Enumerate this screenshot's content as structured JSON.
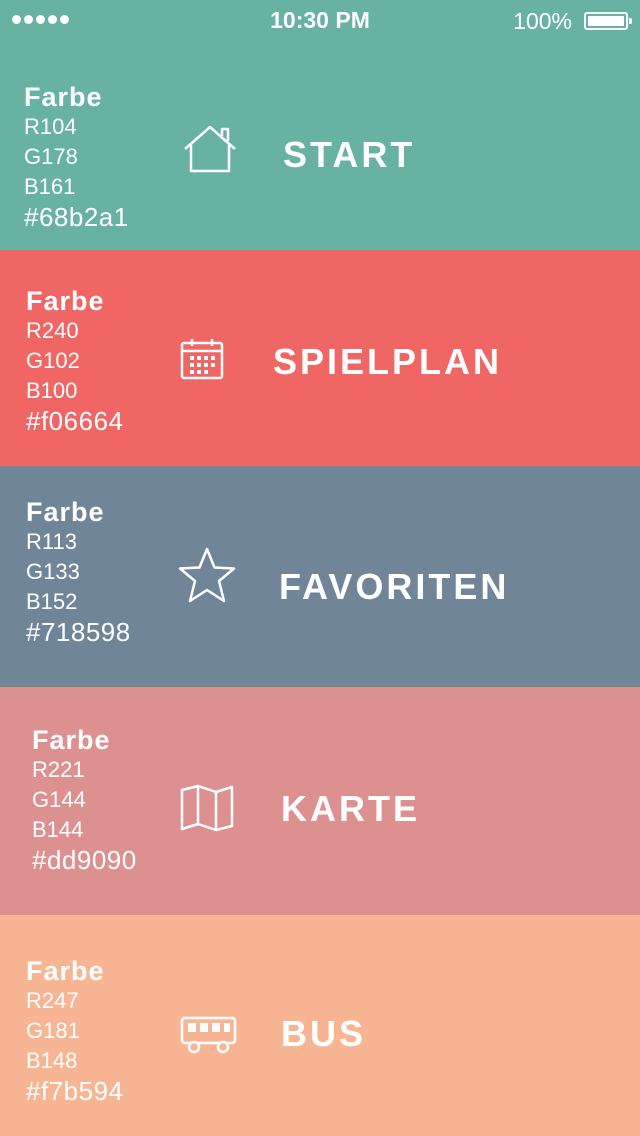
{
  "status_bar": {
    "time": "10:30 PM",
    "battery": "100%"
  },
  "items": [
    {
      "title": "START",
      "farbe": "Farbe",
      "r": "R104",
      "g": "G178",
      "b": "B161",
      "hex": "#68b2a1",
      "icon": "home-icon",
      "color": "#68b2a1"
    },
    {
      "title": "SPIELPLAN",
      "farbe": "Farbe",
      "r": "R240",
      "g": "G102",
      "b": "B100",
      "hex": "#f06664",
      "icon": "calendar-icon",
      "color": "#f06664"
    },
    {
      "title": "FAVORITEN",
      "farbe": "Farbe",
      "r": "R113",
      "g": "G133",
      "b": "B152",
      "hex": "#718598",
      "icon": "star-icon",
      "color": "#718598"
    },
    {
      "title": "KARTE",
      "farbe": "Farbe",
      "r": "R221",
      "g": "G144",
      "b": "B144",
      "hex": "#dd9090",
      "icon": "map-icon",
      "color": "#dd9090"
    },
    {
      "title": "BUS",
      "farbe": "Farbe",
      "r": "R247",
      "g": "G181",
      "b": "B148",
      "hex": "#f7b594",
      "icon": "bus-icon",
      "color": "#f7b594"
    }
  ]
}
